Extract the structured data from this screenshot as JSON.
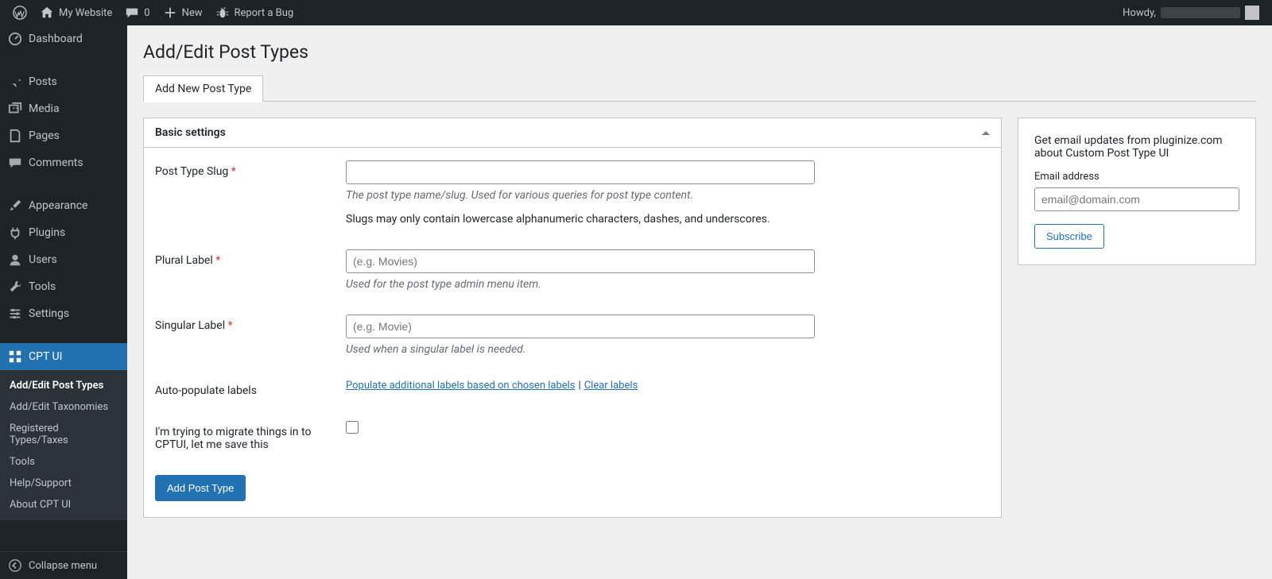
{
  "adminbar": {
    "site_name": "My Website",
    "comments_count": "0",
    "new_label": "New",
    "report_bug": "Report a Bug",
    "greeting": "Howdy,"
  },
  "sidebar": {
    "items": [
      {
        "label": "Dashboard"
      },
      {
        "label": "Posts"
      },
      {
        "label": "Media"
      },
      {
        "label": "Pages"
      },
      {
        "label": "Comments"
      },
      {
        "label": "Appearance"
      },
      {
        "label": "Plugins"
      },
      {
        "label": "Users"
      },
      {
        "label": "Tools"
      },
      {
        "label": "Settings"
      },
      {
        "label": "CPT UI"
      }
    ],
    "submenu": [
      {
        "label": "Add/Edit Post Types"
      },
      {
        "label": "Add/Edit Taxonomies"
      },
      {
        "label": "Registered Types/Taxes"
      },
      {
        "label": "Tools"
      },
      {
        "label": "Help/Support"
      },
      {
        "label": "About CPT UI"
      }
    ],
    "collapse": "Collapse menu"
  },
  "page": {
    "title": "Add/Edit Post Types",
    "tab": "Add New Post Type",
    "panel_head": "Basic settings",
    "slug_label": "Post Type Slug",
    "slug_desc": "The post type name/slug. Used for various queries for post type content.",
    "slug_note": "Slugs may only contain lowercase alphanumeric characters, dashes, and underscores.",
    "plural_label": "Plural Label",
    "plural_placeholder": "(e.g. Movies)",
    "plural_desc": "Used for the post type admin menu item.",
    "singular_label": "Singular Label",
    "singular_placeholder": "(e.g. Movie)",
    "singular_desc": "Used when a singular label is needed.",
    "autopop_label": "Auto-populate labels",
    "autopop_link1": "Populate additional labels based on chosen labels",
    "autopop_link2": "Clear labels",
    "migrate_label": "I'm trying to migrate things in to CPTUI, let me save this",
    "submit": "Add Post Type"
  },
  "sidebox": {
    "text": "Get email updates from pluginize.com about Custom Post Type UI",
    "email_label": "Email address",
    "email_placeholder": "email@domain.com",
    "subscribe": "Subscribe"
  }
}
